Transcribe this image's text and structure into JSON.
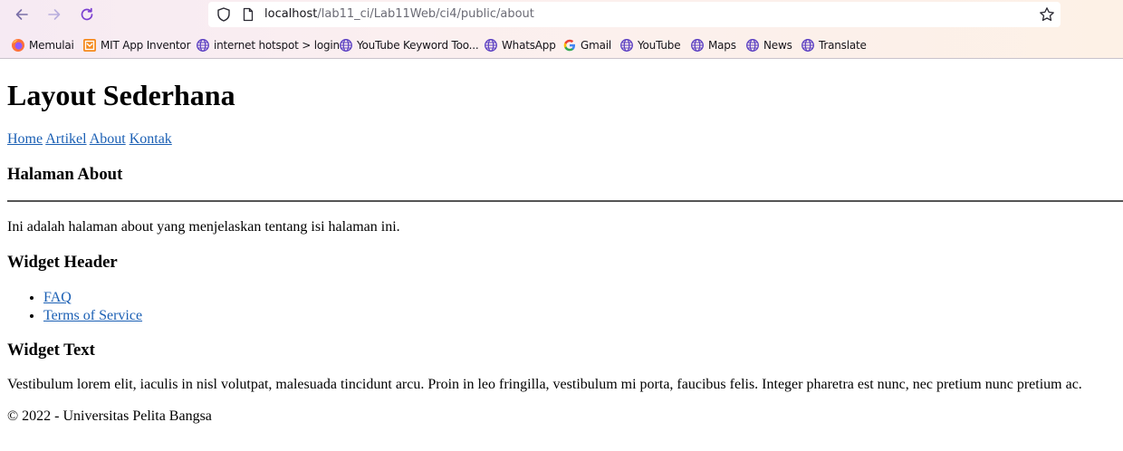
{
  "browser": {
    "url_host": "localhost",
    "url_path": "/lab11_ci/Lab11Web/ci4/public/about",
    "bookmarks": [
      {
        "label": "Memulai",
        "icon": "firefox-icon"
      },
      {
        "label": "MIT App Inventor",
        "icon": "app-inventor-icon"
      },
      {
        "label": "internet hotspot > login",
        "icon": "globe-icon"
      },
      {
        "label": "YouTube Keyword Too...",
        "icon": "globe-icon"
      },
      {
        "label": "WhatsApp",
        "icon": "globe-icon"
      },
      {
        "label": "Gmail",
        "icon": "google-icon"
      },
      {
        "label": "YouTube",
        "icon": "globe-icon"
      },
      {
        "label": "Maps",
        "icon": "globe-icon"
      },
      {
        "label": "News",
        "icon": "globe-icon"
      },
      {
        "label": "Translate",
        "icon": "globe-icon"
      }
    ]
  },
  "page": {
    "title": "Layout Sederhana",
    "nav": [
      "Home",
      "Artikel",
      "About",
      "Kontak"
    ],
    "section_title": "Halaman About",
    "intro": "Ini adalah halaman about yang menjelaskan tentang isi halaman ini.",
    "widget_header": {
      "title": "Widget Header",
      "links": [
        "FAQ",
        "Terms of Service"
      ]
    },
    "widget_text": {
      "title": "Widget Text",
      "body": "Vestibulum lorem elit, iaculis in nisl volutpat, malesuada tincidunt arcu. Proin in leo fringilla, vestibulum mi porta, faucibus felis. Integer pharetra est nunc, nec pretium nunc pretium ac."
    },
    "footer": "© 2022 - Universitas Pelita Bangsa"
  },
  "colors": {
    "link": "#0000ee",
    "globe_icon": "#5b3fc2"
  }
}
